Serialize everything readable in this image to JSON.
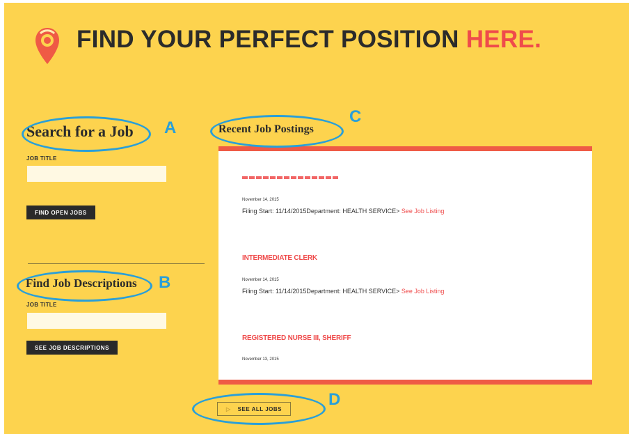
{
  "header": {
    "headline_main": "FIND YOUR PERFECT POSITION",
    "headline_accent": "HERE."
  },
  "search_job": {
    "title": "Search for a Job",
    "field_label": "JOB TITLE",
    "input_value": "",
    "button_label": "FIND OPEN JOBS"
  },
  "job_descriptions": {
    "title": "Find Job Descriptions",
    "field_label": "JOB TITLE",
    "input_value": "",
    "button_label": "SEE JOB DESCRIPTIONS"
  },
  "recent_postings": {
    "title": "Recent Job Postings",
    "items": [
      {
        "title": "",
        "date": "November 14, 2015",
        "meta": "Filing Start: 11/14/2015Department: HEALTH SERVICE>",
        "link": "See Job Listing"
      },
      {
        "title": "INTERMEDIATE CLERK",
        "date": "November 14, 2015",
        "meta": "Filing Start: 11/14/2015Department: HEALTH SERVICE>",
        "link": "See Job Listing"
      },
      {
        "title": "REGISTERED NURSE III, SHERIFF",
        "date": "November 13, 2015"
      }
    ]
  },
  "see_all": {
    "icon": "play-triangle-icon",
    "label": "SEE ALL JOBS"
  },
  "callouts": {
    "a": "A",
    "b": "B",
    "c": "C",
    "d": "D",
    "color": "#2a9fd8"
  },
  "colors": {
    "background": "#fdd34e",
    "accent": "#ef4b4b",
    "panel_border": "#ef5a45",
    "dark_button": "#2a2a2a"
  }
}
